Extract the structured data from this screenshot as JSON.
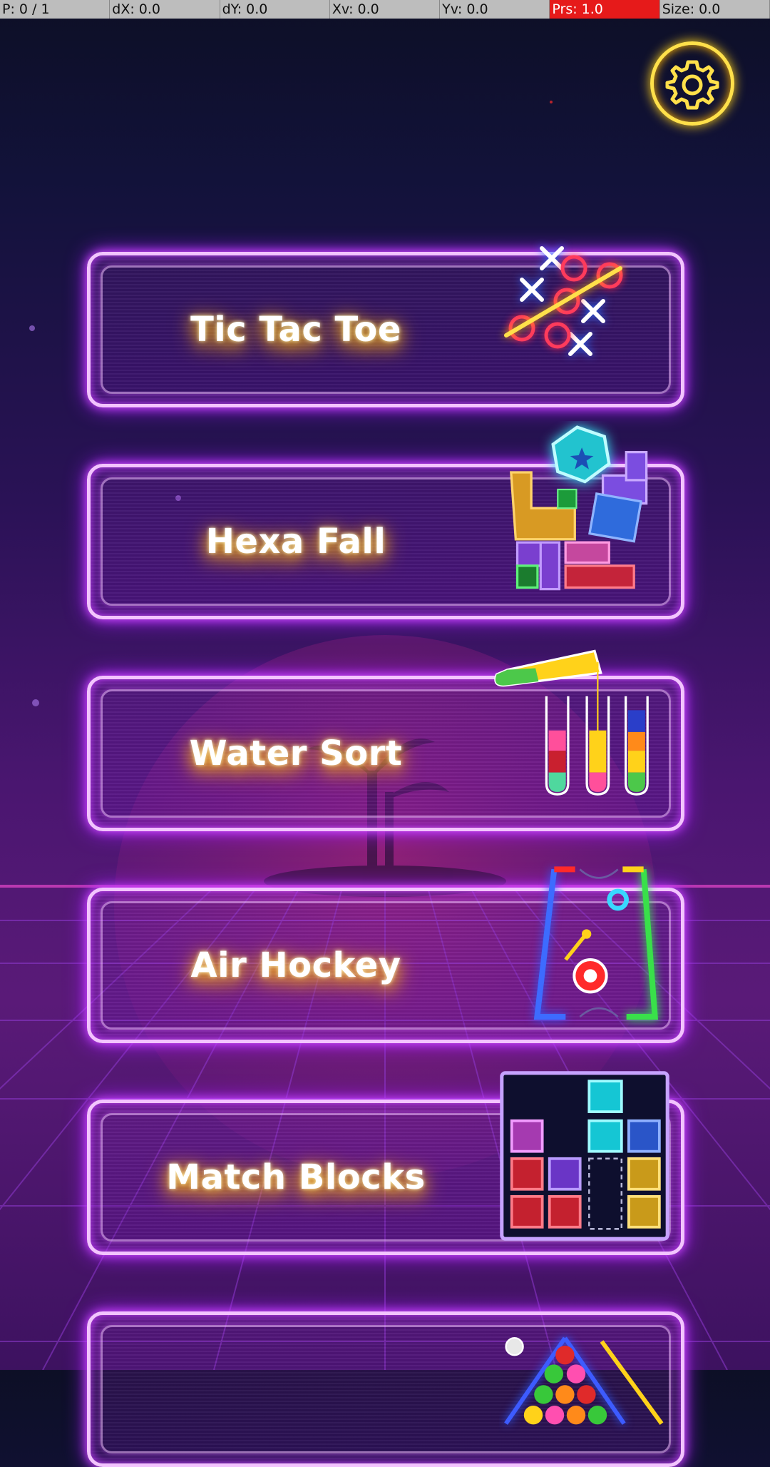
{
  "status_bar": {
    "pointer": "P: 0 / 1",
    "dx": "dX: 0.0",
    "dy": "dY: 0.0",
    "xv": "Xv: 0.0",
    "yv": "Yv: 0.0",
    "prs": "Prs: 1.0",
    "size": "Size: 0.0"
  },
  "settings": {
    "icon": "gear-icon"
  },
  "games": [
    {
      "title": "Tic Tac Toe",
      "icon": "tic-tac-toe-icon"
    },
    {
      "title": "Hexa Fall",
      "icon": "hexa-fall-icon"
    },
    {
      "title": "Water Sort",
      "icon": "water-sort-icon"
    },
    {
      "title": "Air Hockey",
      "icon": "air-hockey-icon"
    },
    {
      "title": "Match Blocks",
      "icon": "match-blocks-icon"
    },
    {
      "title": "",
      "icon": "billiards-icon"
    }
  ],
  "colors": {
    "accent_neon": "#f3c4ff",
    "gear": "#ffe04a",
    "status_hot": "#e61a1a"
  }
}
